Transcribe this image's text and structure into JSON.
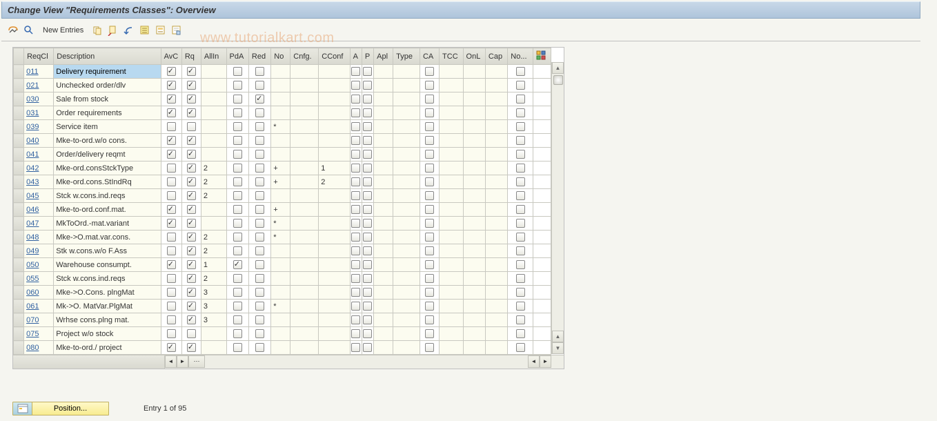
{
  "title": "Change View \"Requirements Classes\": Overview",
  "toolbar": {
    "new_entries": "New Entries"
  },
  "watermark": "www.tutorialkart.com",
  "columns": [
    "ReqCl",
    "Description",
    "AvC",
    "Rq",
    "AllIn",
    "PdA",
    "Red",
    "No",
    "Cnfg.",
    "CConf",
    "A",
    "P",
    "Apl",
    "Type",
    "CA",
    "TCC",
    "OnL",
    "Cap",
    "No..."
  ],
  "rows": [
    {
      "reqcl": "011",
      "desc": "Delivery requirement",
      "avc": true,
      "rq": true,
      "allin": "",
      "pda": false,
      "red": false,
      "no": "",
      "cnfg": "",
      "cconf": "",
      "a": false,
      "p": false,
      "apl": "",
      "type": "",
      "ca": false,
      "tcc": "",
      "onl": "",
      "cap": "",
      "noo": false,
      "sel": true
    },
    {
      "reqcl": "021",
      "desc": "Unchecked order/dlv",
      "avc": true,
      "rq": true,
      "allin": "",
      "pda": false,
      "red": false,
      "no": "",
      "cnfg": "",
      "cconf": "",
      "a": false,
      "p": false,
      "apl": "",
      "type": "",
      "ca": false,
      "tcc": "",
      "onl": "",
      "cap": "",
      "noo": false
    },
    {
      "reqcl": "030",
      "desc": "Sale from stock",
      "avc": true,
      "rq": true,
      "allin": "",
      "pda": false,
      "red": true,
      "no": "",
      "cnfg": "",
      "cconf": "",
      "a": false,
      "p": false,
      "apl": "",
      "type": "",
      "ca": false,
      "tcc": "",
      "onl": "",
      "cap": "",
      "noo": false
    },
    {
      "reqcl": "031",
      "desc": "Order requirements",
      "avc": true,
      "rq": true,
      "allin": "",
      "pda": false,
      "red": false,
      "no": "",
      "cnfg": "",
      "cconf": "",
      "a": false,
      "p": false,
      "apl": "",
      "type": "",
      "ca": false,
      "tcc": "",
      "onl": "",
      "cap": "",
      "noo": false
    },
    {
      "reqcl": "039",
      "desc": "Service item",
      "avc": false,
      "rq": false,
      "allin": "",
      "pda": false,
      "red": false,
      "no": "*",
      "cnfg": "",
      "cconf": "",
      "a": false,
      "p": false,
      "apl": "",
      "type": "",
      "ca": false,
      "tcc": "",
      "onl": "",
      "cap": "",
      "noo": false
    },
    {
      "reqcl": "040",
      "desc": "Mke-to-ord.w/o cons.",
      "avc": true,
      "rq": true,
      "allin": "",
      "pda": false,
      "red": false,
      "no": "",
      "cnfg": "",
      "cconf": "",
      "a": false,
      "p": false,
      "apl": "",
      "type": "",
      "ca": false,
      "tcc": "",
      "onl": "",
      "cap": "",
      "noo": false
    },
    {
      "reqcl": "041",
      "desc": "Order/delivery reqmt",
      "avc": true,
      "rq": true,
      "allin": "",
      "pda": false,
      "red": false,
      "no": "",
      "cnfg": "",
      "cconf": "",
      "a": false,
      "p": false,
      "apl": "",
      "type": "",
      "ca": false,
      "tcc": "",
      "onl": "",
      "cap": "",
      "noo": false
    },
    {
      "reqcl": "042",
      "desc": "Mke-ord.consStckType",
      "avc": false,
      "rq": true,
      "allin": "2",
      "pda": false,
      "red": false,
      "no": "+",
      "cnfg": "",
      "cconf": "1",
      "a": false,
      "p": false,
      "apl": "",
      "type": "",
      "ca": false,
      "tcc": "",
      "onl": "",
      "cap": "",
      "noo": false
    },
    {
      "reqcl": "043",
      "desc": "Mke-ord.cons.StIndRq",
      "avc": false,
      "rq": true,
      "allin": "2",
      "pda": false,
      "red": false,
      "no": "+",
      "cnfg": "",
      "cconf": "2",
      "a": false,
      "p": false,
      "apl": "",
      "type": "",
      "ca": false,
      "tcc": "",
      "onl": "",
      "cap": "",
      "noo": false
    },
    {
      "reqcl": "045",
      "desc": "Stck w.cons.ind.reqs",
      "avc": false,
      "rq": true,
      "allin": "2",
      "pda": false,
      "red": false,
      "no": "",
      "cnfg": "",
      "cconf": "",
      "a": false,
      "p": false,
      "apl": "",
      "type": "",
      "ca": false,
      "tcc": "",
      "onl": "",
      "cap": "",
      "noo": false
    },
    {
      "reqcl": "046",
      "desc": "Mke-to-ord.conf.mat.",
      "avc": true,
      "rq": true,
      "allin": "",
      "pda": false,
      "red": false,
      "no": "+",
      "cnfg": "",
      "cconf": "",
      "a": false,
      "p": false,
      "apl": "",
      "type": "",
      "ca": false,
      "tcc": "",
      "onl": "",
      "cap": "",
      "noo": false
    },
    {
      "reqcl": "047",
      "desc": "MkToOrd.-mat.variant",
      "avc": true,
      "rq": true,
      "allin": "",
      "pda": false,
      "red": false,
      "no": "*",
      "cnfg": "",
      "cconf": "",
      "a": false,
      "p": false,
      "apl": "",
      "type": "",
      "ca": false,
      "tcc": "",
      "onl": "",
      "cap": "",
      "noo": false
    },
    {
      "reqcl": "048",
      "desc": "Mke->O.mat.var.cons.",
      "avc": false,
      "rq": true,
      "allin": "2",
      "pda": false,
      "red": false,
      "no": "*",
      "cnfg": "",
      "cconf": "",
      "a": false,
      "p": false,
      "apl": "",
      "type": "",
      "ca": false,
      "tcc": "",
      "onl": "",
      "cap": "",
      "noo": false
    },
    {
      "reqcl": "049",
      "desc": "Stk w.cons.w/o F.Ass",
      "avc": false,
      "rq": true,
      "allin": "2",
      "pda": false,
      "red": false,
      "no": "",
      "cnfg": "",
      "cconf": "",
      "a": false,
      "p": false,
      "apl": "",
      "type": "",
      "ca": false,
      "tcc": "",
      "onl": "",
      "cap": "",
      "noo": false
    },
    {
      "reqcl": "050",
      "desc": "Warehouse consumpt.",
      "avc": true,
      "rq": true,
      "allin": "1",
      "pda": true,
      "red": false,
      "no": "",
      "cnfg": "",
      "cconf": "",
      "a": false,
      "p": false,
      "apl": "",
      "type": "",
      "ca": false,
      "tcc": "",
      "onl": "",
      "cap": "",
      "noo": false
    },
    {
      "reqcl": "055",
      "desc": "Stck w.cons.ind.reqs",
      "avc": false,
      "rq": true,
      "allin": "2",
      "pda": false,
      "red": false,
      "no": "",
      "cnfg": "",
      "cconf": "",
      "a": false,
      "p": false,
      "apl": "",
      "type": "",
      "ca": false,
      "tcc": "",
      "onl": "",
      "cap": "",
      "noo": false
    },
    {
      "reqcl": "060",
      "desc": "Mke->O.Cons. plngMat",
      "avc": false,
      "rq": true,
      "allin": "3",
      "pda": false,
      "red": false,
      "no": "",
      "cnfg": "",
      "cconf": "",
      "a": false,
      "p": false,
      "apl": "",
      "type": "",
      "ca": false,
      "tcc": "",
      "onl": "",
      "cap": "",
      "noo": false
    },
    {
      "reqcl": "061",
      "desc": "Mk->O. MatVar.PlgMat",
      "avc": false,
      "rq": true,
      "allin": "3",
      "pda": false,
      "red": false,
      "no": "*",
      "cnfg": "",
      "cconf": "",
      "a": false,
      "p": false,
      "apl": "",
      "type": "",
      "ca": false,
      "tcc": "",
      "onl": "",
      "cap": "",
      "noo": false
    },
    {
      "reqcl": "070",
      "desc": "Wrhse cons.plng mat.",
      "avc": false,
      "rq": true,
      "allin": "3",
      "pda": false,
      "red": false,
      "no": "",
      "cnfg": "",
      "cconf": "",
      "a": false,
      "p": false,
      "apl": "",
      "type": "",
      "ca": false,
      "tcc": "",
      "onl": "",
      "cap": "",
      "noo": false
    },
    {
      "reqcl": "075",
      "desc": "Project w/o stock",
      "avc": false,
      "rq": false,
      "allin": "",
      "pda": false,
      "red": false,
      "no": "",
      "cnfg": "",
      "cconf": "",
      "a": false,
      "p": false,
      "apl": "",
      "type": "",
      "ca": false,
      "tcc": "",
      "onl": "",
      "cap": "",
      "noo": false
    },
    {
      "reqcl": "080",
      "desc": "Mke-to-ord./ project",
      "avc": true,
      "rq": true,
      "allin": "",
      "pda": false,
      "red": false,
      "no": "",
      "cnfg": "",
      "cconf": "",
      "a": false,
      "p": false,
      "apl": "",
      "type": "",
      "ca": false,
      "tcc": "",
      "onl": "",
      "cap": "",
      "noo": false
    }
  ],
  "position_button": "Position...",
  "entry_text": "Entry 1 of 95"
}
